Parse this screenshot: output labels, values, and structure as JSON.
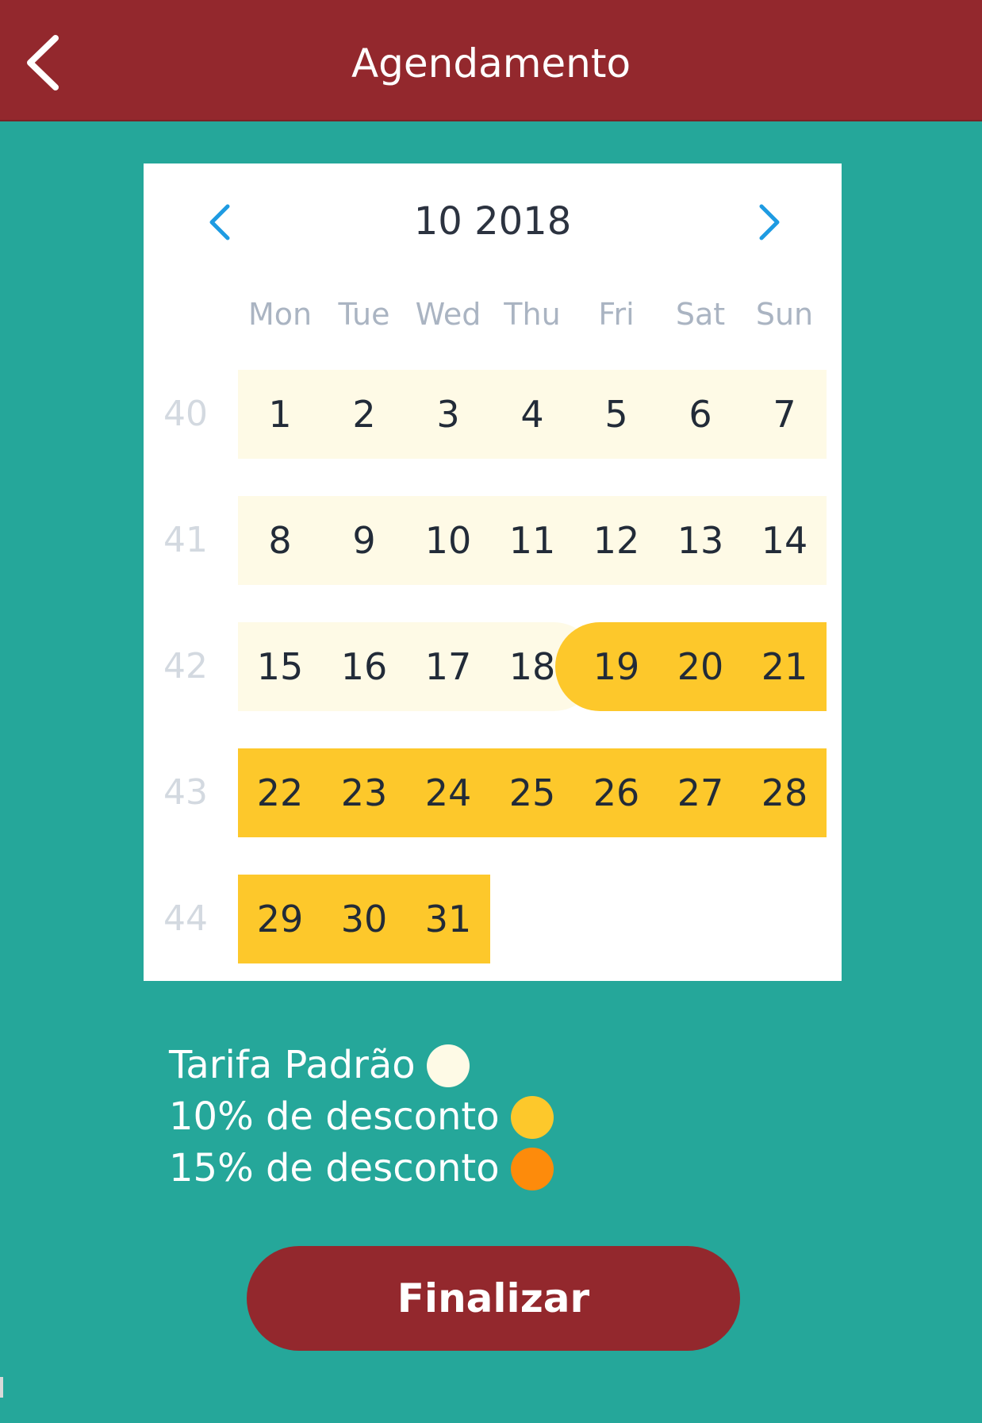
{
  "header": {
    "title": "Agendamento",
    "back_icon": "chevron-left-icon"
  },
  "calendar": {
    "month_label": "10 2018",
    "prev_icon": "chevron-left-icon",
    "next_icon": "chevron-right-icon",
    "weekdays": [
      "Mon",
      "Tue",
      "Wed",
      "Thu",
      "Fri",
      "Sat",
      "Sun"
    ],
    "weeks": [
      {
        "number": "40",
        "days": [
          "1",
          "2",
          "3",
          "4",
          "5",
          "6",
          "7"
        ]
      },
      {
        "number": "41",
        "days": [
          "8",
          "9",
          "10",
          "11",
          "12",
          "13",
          "14"
        ]
      },
      {
        "number": "42",
        "days": [
          "15",
          "16",
          "17",
          "18",
          "19",
          "20",
          "21"
        ]
      },
      {
        "number": "43",
        "days": [
          "22",
          "23",
          "24",
          "25",
          "26",
          "27",
          "28"
        ]
      },
      {
        "number": "44",
        "days": [
          "29",
          "30",
          "31"
        ]
      }
    ],
    "rates": {
      "standard": [
        "1",
        "2",
        "3",
        "4",
        "5",
        "6",
        "7",
        "8",
        "9",
        "10",
        "11",
        "12",
        "13",
        "14",
        "15",
        "16",
        "17",
        "18"
      ],
      "discount_10": [
        "19",
        "20",
        "21",
        "22",
        "23",
        "24",
        "25",
        "26",
        "27",
        "28",
        "29",
        "30",
        "31"
      ],
      "discount_15": []
    }
  },
  "legend": {
    "items": [
      {
        "label": "Tarifa Padrão",
        "color": "#fefae6"
      },
      {
        "label": "10% de desconto",
        "color": "#fdc82b"
      },
      {
        "label": "15% de desconto",
        "color": "#fd8b0b"
      }
    ]
  },
  "actions": {
    "finalize_label": "Finalizar"
  },
  "colors": {
    "header_bg": "#93282d",
    "page_bg": "#25a79a",
    "nav_arrow": "#1e9be2",
    "standard_fill": "#fefae6",
    "discount_10_fill": "#fdc82b"
  }
}
